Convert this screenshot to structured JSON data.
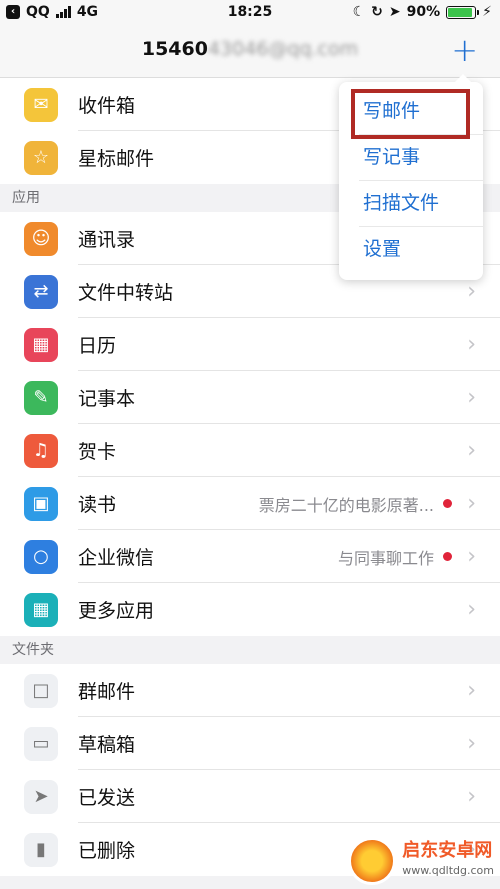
{
  "status_bar": {
    "carrier": "QQ",
    "network": "4G",
    "time": "18:25",
    "battery": "90%"
  },
  "header": {
    "account_visible": "15460",
    "account_blurred": "43046@qq.com",
    "add_icon": "plus-icon"
  },
  "top_list": [
    {
      "label": "收件箱",
      "icon": "inbox-icon",
      "color": "#f4c53a"
    },
    {
      "label": "星标邮件",
      "icon": "star-icon",
      "color": "#f0b43a"
    }
  ],
  "apps_section": {
    "header": "应用",
    "items": [
      {
        "label": "通讯录",
        "icon": "contacts-icon",
        "color": "#f08a2c",
        "sub": ""
      },
      {
        "label": "文件中转站",
        "icon": "transfer-icon",
        "color": "#3a74d6",
        "sub": ""
      },
      {
        "label": "日历",
        "icon": "calendar-icon",
        "color": "#e8455a",
        "sub": ""
      },
      {
        "label": "记事本",
        "icon": "notepad-icon",
        "color": "#3cb85c",
        "sub": ""
      },
      {
        "label": "贺卡",
        "icon": "card-icon",
        "color": "#ee5a3c",
        "sub": ""
      },
      {
        "label": "读书",
        "icon": "book-icon",
        "color": "#2e9be6",
        "sub": "票房二十亿的电影原著..."
      },
      {
        "label": "企业微信",
        "icon": "wework-icon",
        "color": "#2e7fe0",
        "sub": "与同事聊工作"
      },
      {
        "label": "更多应用",
        "icon": "grid-icon",
        "color": "#1bb0b8",
        "sub": ""
      }
    ]
  },
  "folders_section": {
    "header": "文件夹",
    "items": [
      {
        "label": "群邮件",
        "icon": "group-mail-icon"
      },
      {
        "label": "草稿箱",
        "icon": "drafts-icon"
      },
      {
        "label": "已发送",
        "icon": "sent-icon"
      },
      {
        "label": "已删除",
        "icon": "trash-icon"
      }
    ]
  },
  "popup_menu": {
    "items": [
      "写邮件",
      "写记事",
      "扫描文件",
      "设置"
    ],
    "highlighted": "写邮件"
  },
  "watermark": {
    "name": "启东安卓网",
    "url": "www.qdltdg.com"
  }
}
